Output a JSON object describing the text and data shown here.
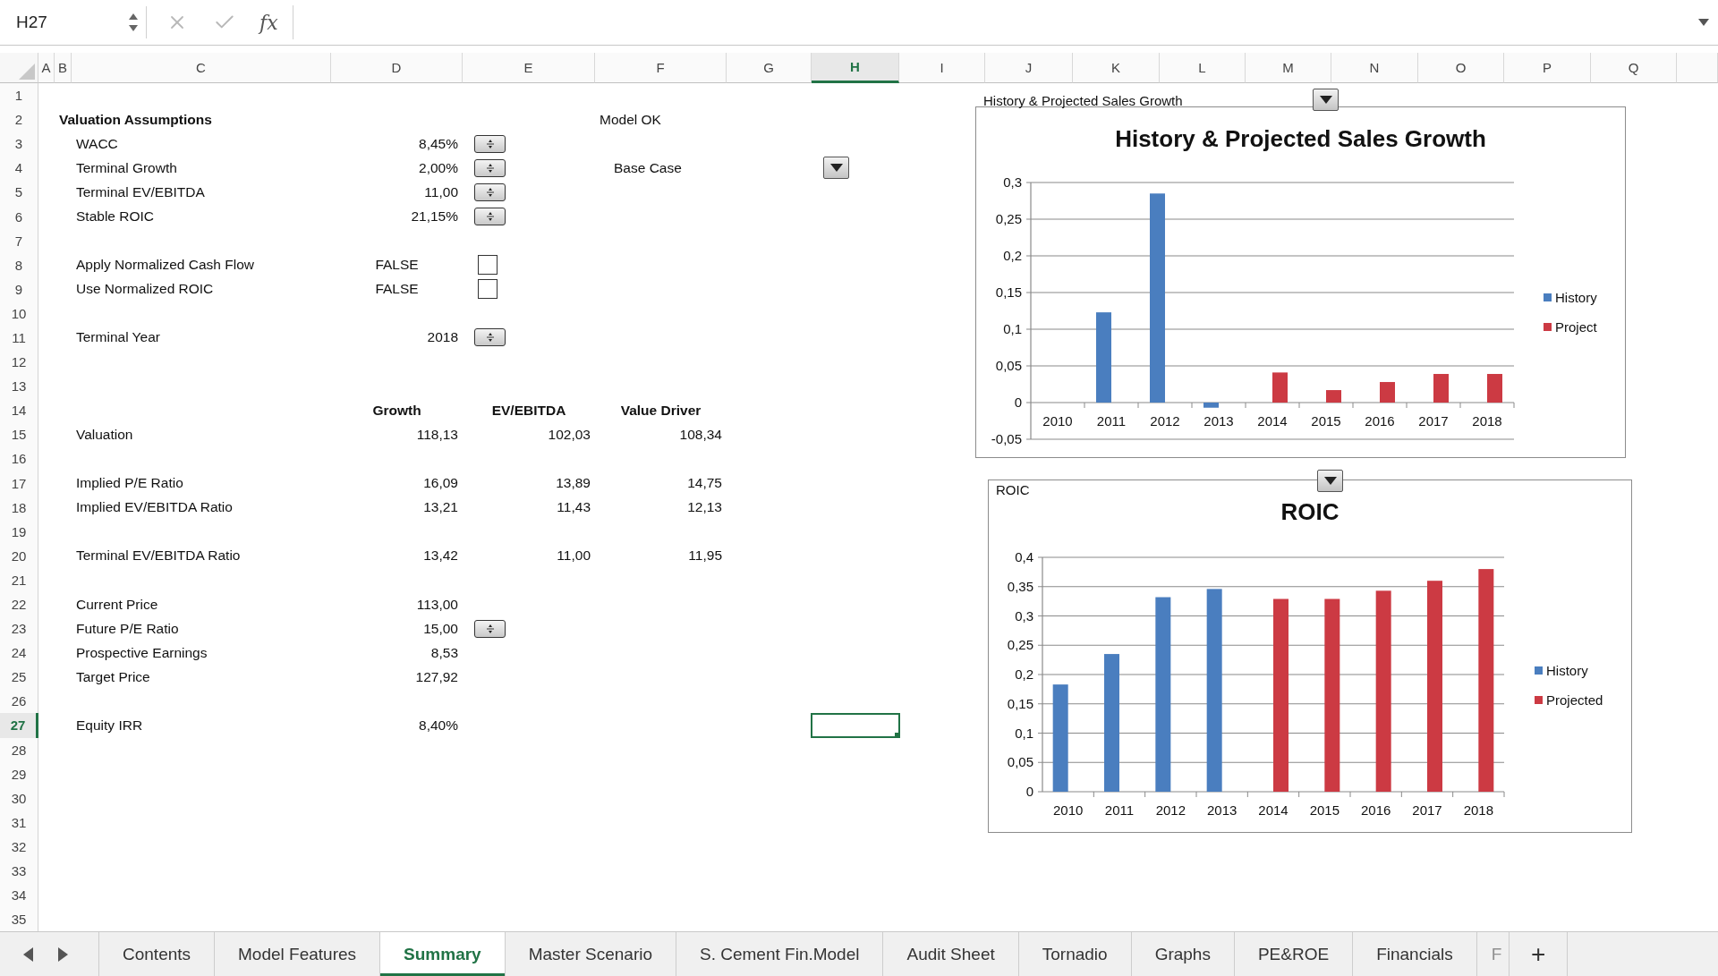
{
  "formula_bar": {
    "name_box": "H27",
    "fx_label": "fx"
  },
  "sheet": {
    "columns": [
      {
        "label": "A",
        "selected": false
      },
      {
        "label": "B",
        "selected": false
      },
      {
        "label": "C",
        "selected": false
      },
      {
        "label": "D",
        "selected": false
      },
      {
        "label": "E",
        "selected": false
      },
      {
        "label": "F",
        "selected": false
      },
      {
        "label": "G",
        "selected": false
      },
      {
        "label": "H",
        "selected": true
      },
      {
        "label": "I",
        "selected": false
      },
      {
        "label": "J",
        "selected": false
      },
      {
        "label": "K",
        "selected": false
      },
      {
        "label": "L",
        "selected": false
      },
      {
        "label": "M",
        "selected": false
      },
      {
        "label": "N",
        "selected": false
      },
      {
        "label": "O",
        "selected": false
      },
      {
        "label": "P",
        "selected": false
      },
      {
        "label": "Q",
        "selected": false
      }
    ],
    "rows": [
      {
        "number": "1",
        "selected": false
      },
      {
        "number": "2",
        "selected": false,
        "cells": {
          "B": {
            "kind": "title",
            "text": "Valuation Assumptions"
          },
          "F": {
            "kind": "text",
            "text": "Model OK"
          }
        }
      },
      {
        "number": "3",
        "selected": false,
        "cells": {
          "C": {
            "kind": "text",
            "text": "WACC"
          },
          "D": {
            "kind": "number",
            "text": "8,45%"
          },
          "E": {
            "kind": "spinner"
          }
        }
      },
      {
        "number": "4",
        "selected": false,
        "cells": {
          "C": {
            "kind": "text",
            "text": "Terminal Growth"
          },
          "D": {
            "kind": "number",
            "text": "2,00%"
          },
          "E": {
            "kind": "spinner"
          },
          "F": {
            "kind": "indented",
            "text": "Base Case"
          },
          "H": {
            "kind": "dropdown"
          }
        }
      },
      {
        "number": "5",
        "selected": false,
        "cells": {
          "C": {
            "kind": "text",
            "text": "Terminal EV/EBITDA"
          },
          "D": {
            "kind": "number",
            "text": "11,00"
          },
          "E": {
            "kind": "spinner"
          }
        }
      },
      {
        "number": "6",
        "selected": false,
        "cells": {
          "C": {
            "kind": "text",
            "text": "Stable ROIC"
          },
          "D": {
            "kind": "number",
            "text": "21,15%"
          },
          "E": {
            "kind": "spinner"
          }
        }
      },
      {
        "number": "7",
        "selected": false
      },
      {
        "number": "8",
        "selected": false,
        "cells": {
          "C": {
            "kind": "text",
            "text": "Apply Normalized Cash Flow"
          },
          "D": {
            "kind": "boolean",
            "text": "FALSE"
          },
          "E": {
            "kind": "checkbox",
            "checked": false
          }
        }
      },
      {
        "number": "9",
        "selected": false,
        "cells": {
          "C": {
            "kind": "text",
            "text": "Use Normalized ROIC"
          },
          "D": {
            "kind": "boolean",
            "text": "FALSE"
          },
          "E": {
            "kind": "checkbox",
            "checked": false
          }
        }
      },
      {
        "number": "10",
        "selected": false
      },
      {
        "number": "11",
        "selected": false,
        "cells": {
          "C": {
            "kind": "text",
            "text": "Terminal Year"
          },
          "D": {
            "kind": "number",
            "text": "2018"
          },
          "E": {
            "kind": "spinner"
          }
        }
      },
      {
        "number": "12",
        "selected": false
      },
      {
        "number": "13",
        "selected": false
      },
      {
        "number": "14",
        "selected": false,
        "cells": {
          "D": {
            "kind": "heading",
            "text": "Growth"
          },
          "E": {
            "kind": "heading",
            "text": "EV/EBITDA"
          },
          "F": {
            "kind": "heading",
            "text": "Value Driver"
          }
        }
      },
      {
        "number": "15",
        "selected": false,
        "cells": {
          "C": {
            "kind": "text",
            "text": "Valuation"
          },
          "D": {
            "kind": "number",
            "text": "118,13"
          },
          "E": {
            "kind": "number",
            "text": "102,03"
          },
          "F": {
            "kind": "number",
            "text": "108,34"
          }
        }
      },
      {
        "number": "16",
        "selected": false
      },
      {
        "number": "17",
        "selected": false,
        "cells": {
          "C": {
            "kind": "text",
            "text": "Implied P/E Ratio"
          },
          "D": {
            "kind": "number",
            "text": "16,09"
          },
          "E": {
            "kind": "number",
            "text": "13,89"
          },
          "F": {
            "kind": "number",
            "text": "14,75"
          }
        }
      },
      {
        "number": "18",
        "selected": false,
        "cells": {
          "C": {
            "kind": "text",
            "text": "Implied EV/EBITDA Ratio"
          },
          "D": {
            "kind": "number",
            "text": "13,21"
          },
          "E": {
            "kind": "number",
            "text": "11,43"
          },
          "F": {
            "kind": "number",
            "text": "12,13"
          }
        }
      },
      {
        "number": "19",
        "selected": false
      },
      {
        "number": "20",
        "selected": false,
        "cells": {
          "C": {
            "kind": "text",
            "text": "Terminal EV/EBITDA Ratio"
          },
          "D": {
            "kind": "number",
            "text": "13,42"
          },
          "E": {
            "kind": "number",
            "text": "11,00"
          },
          "F": {
            "kind": "number",
            "text": "11,95"
          }
        }
      },
      {
        "number": "21",
        "selected": false
      },
      {
        "number": "22",
        "selected": false,
        "cells": {
          "C": {
            "kind": "text",
            "text": "Current Price"
          },
          "D": {
            "kind": "number",
            "text": "113,00"
          }
        }
      },
      {
        "number": "23",
        "selected": false,
        "cells": {
          "C": {
            "kind": "text",
            "text": "Future P/E Ratio"
          },
          "D": {
            "kind": "number",
            "text": "15,00"
          },
          "E": {
            "kind": "spinner"
          }
        }
      },
      {
        "number": "24",
        "selected": false,
        "cells": {
          "C": {
            "kind": "text",
            "text": "Prospective Earnings"
          },
          "D": {
            "kind": "number",
            "text": "8,53"
          }
        }
      },
      {
        "number": "25",
        "selected": false,
        "cells": {
          "C": {
            "kind": "text",
            "text": "Target Price"
          },
          "D": {
            "kind": "number",
            "text": "127,92"
          }
        }
      },
      {
        "number": "26",
        "selected": false
      },
      {
        "number": "27",
        "selected": true,
        "cells": {
          "C": {
            "kind": "text",
            "text": "Equity IRR"
          },
          "D": {
            "kind": "number",
            "text": "8,40%"
          }
        }
      },
      {
        "number": "28",
        "selected": false
      },
      {
        "number": "29",
        "selected": false
      },
      {
        "number": "30",
        "selected": false
      },
      {
        "number": "31",
        "selected": false
      },
      {
        "number": "32",
        "selected": false
      },
      {
        "number": "33",
        "selected": false
      },
      {
        "number": "34",
        "selected": false
      },
      {
        "number": "35",
        "selected": false
      }
    ]
  },
  "charts": [
    {
      "label": "History & Projected Sales Growth",
      "chart_data": {
        "type": "bar",
        "title": "History & Projected Sales Growth",
        "categories": [
          "2010",
          "2011",
          "2012",
          "2013",
          "2014",
          "2015",
          "2016",
          "2017",
          "2018"
        ],
        "series": [
          {
            "name": "History",
            "color": "#4a7ebf",
            "values": [
              null,
              0.123,
              0.285,
              -0.007,
              null,
              null,
              null,
              null,
              null
            ]
          },
          {
            "name": "Project",
            "color": "#cc3a43",
            "values": [
              null,
              null,
              null,
              null,
              0.041,
              0.017,
              0.028,
              0.039,
              0.039
            ]
          }
        ],
        "ylim": [
          -0.05,
          0.3
        ],
        "grid": true,
        "yticks": [
          {
            "value": -0.05,
            "label": "-0,05"
          },
          {
            "value": 0,
            "label": "0"
          },
          {
            "value": 0.05,
            "label": "0,05"
          },
          {
            "value": 0.1,
            "label": "0,1"
          },
          {
            "value": 0.15,
            "label": "0,15"
          },
          {
            "value": 0.2,
            "label": "0,2"
          },
          {
            "value": 0.25,
            "label": "0,25"
          },
          {
            "value": 0.3,
            "label": "0,3"
          }
        ]
      }
    },
    {
      "label": "ROIC",
      "chart_data": {
        "type": "bar",
        "title": "ROIC",
        "categories": [
          "2010",
          "2011",
          "2012",
          "2013",
          "2014",
          "2015",
          "2016",
          "2017",
          "2018"
        ],
        "series": [
          {
            "name": "History",
            "color": "#4a7ebf",
            "values": [
              0.183,
              0.235,
              0.332,
              0.346,
              null,
              null,
              null,
              null,
              null
            ]
          },
          {
            "name": "Projected",
            "color": "#cc3a43",
            "values": [
              null,
              null,
              null,
              null,
              0.329,
              0.329,
              0.343,
              0.36,
              0.38
            ]
          }
        ],
        "ylim": [
          0,
          0.4
        ],
        "grid": true,
        "yticks": [
          {
            "value": 0,
            "label": "0"
          },
          {
            "value": 0.05,
            "label": "0,05"
          },
          {
            "value": 0.1,
            "label": "0,1"
          },
          {
            "value": 0.15,
            "label": "0,15"
          },
          {
            "value": 0.2,
            "label": "0,2"
          },
          {
            "value": 0.25,
            "label": "0,25"
          },
          {
            "value": 0.3,
            "label": "0,3"
          },
          {
            "value": 0.35,
            "label": "0,35"
          },
          {
            "value": 0.4,
            "label": "0,4"
          }
        ]
      }
    }
  ],
  "sheet_tabs": [
    {
      "label": "Contents",
      "selected": false
    },
    {
      "label": "Model Features",
      "selected": false
    },
    {
      "label": "Summary",
      "selected": true
    },
    {
      "label": "Master Scenario",
      "selected": false
    },
    {
      "label": "S. Cement Fin.Model",
      "selected": false
    },
    {
      "label": "Audit Sheet",
      "selected": false
    },
    {
      "label": "Tornadio",
      "selected": false
    },
    {
      "label": "Graphs",
      "selected": false
    },
    {
      "label": "PE&ROE",
      "selected": false
    },
    {
      "label": "Financials",
      "selected": false
    },
    {
      "label": "F",
      "selected": false,
      "partial": true
    }
  ],
  "add_sheet": "+"
}
